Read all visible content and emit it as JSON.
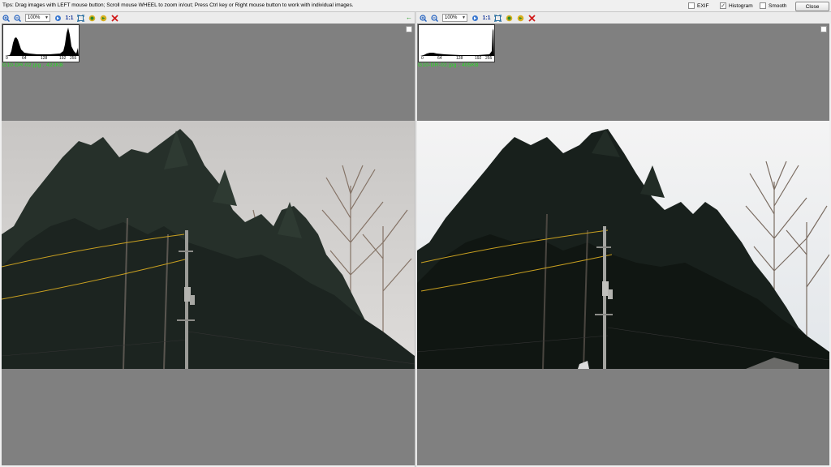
{
  "window": {
    "tips": "Tips: Drag images with LEFT mouse button; Scroll mouse WHEEL to zoom in/out; Press Ctrl key or Right mouse button to work with individual images.",
    "options": [
      {
        "label": "EXIF",
        "checked": false
      },
      {
        "label": "Histogram",
        "checked": true
      },
      {
        "label": "Smooth",
        "checked": false
      }
    ],
    "close_label": "Close"
  },
  "left_pane": {
    "zoom": "100%",
    "actual_size_label": "1:1",
    "file_label": "G10-DR-02.jpg , 422KB",
    "hist_ticks": [
      "0",
      "64",
      "128",
      "192",
      "255"
    ]
  },
  "right_pane": {
    "zoom": "100%",
    "actual_size_label": "1:1",
    "file_label": "G10-DR-02.jpg , 405KB",
    "hist_ticks": [
      "0",
      "64",
      "128",
      "192",
      "255"
    ]
  },
  "colors": {
    "panel_bg": "#808080",
    "file_label": "#22e01e",
    "zoom_icon": "#1f5fbf",
    "close_icon": "#d11a1a",
    "sync_arrow": "#1a9a1a"
  },
  "icons": [
    "zoom-in-icon",
    "zoom-out-icon",
    "fit-icon",
    "fullscreen-icon",
    "prev-image-icon",
    "next-image-icon",
    "close-image-icon",
    "sync-arrow-icon"
  ]
}
